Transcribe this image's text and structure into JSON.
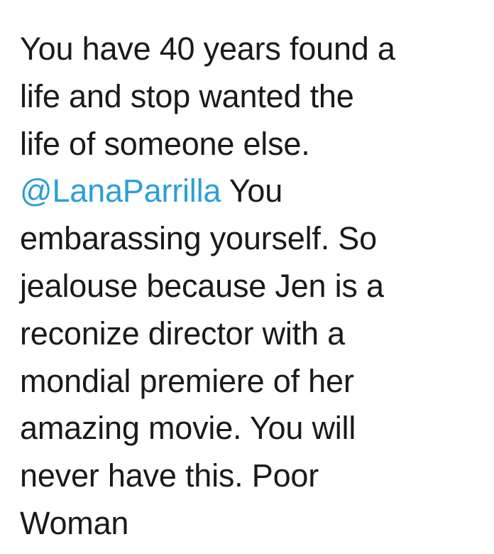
{
  "tweet": {
    "line1": "You have 40 years found a",
    "line2": "life and stop wanted the",
    "line3": "life of someone else.",
    "mention": "@LanaParrilla",
    "line4_rest": " You",
    "line5": "embarassing yourself. So",
    "line6": "jealouse because Jen is a",
    "line7": "reconize director with a",
    "line8": "mondial premiere of her",
    "line9": "amazing movie. You will",
    "line10": "never have this. Poor",
    "line11": "Woman"
  },
  "colors": {
    "text": "#1a1a1a",
    "mention": "#2a9fd6",
    "background": "#ffffff"
  }
}
